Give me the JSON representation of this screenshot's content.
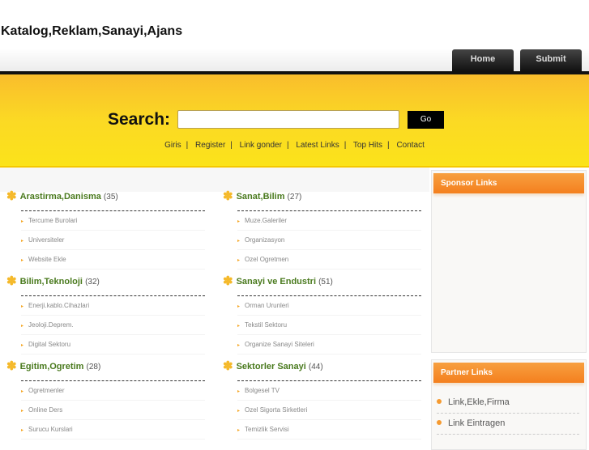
{
  "site_title": "Katalog,Reklam,Sanayi,Ajans",
  "tabs": [
    {
      "label": "Home"
    },
    {
      "label": "Submit"
    }
  ],
  "search": {
    "label": "Search:",
    "value": "",
    "go_label": "Go"
  },
  "links": [
    "Giris",
    "Register",
    "Link gonder",
    "Latest Links",
    "Top Hits",
    "Contact"
  ],
  "link_separator": "|",
  "categories": [
    {
      "title": "Arastirma,Danisma",
      "count": "(35)",
      "items": [
        "Tercume Burolari",
        "Universiteler",
        "Website Ekle"
      ]
    },
    {
      "title": "Sanat,Bilim",
      "count": "(27)",
      "items": [
        "Muze.Galeriler",
        "Organizasyon",
        "Ozel Ogretmen"
      ]
    },
    {
      "title": "Bilim,Teknoloji",
      "count": "(32)",
      "items": [
        "Enerji.kablo.Cihazlari",
        "Jeoloji.Deprem.",
        "Digital Sektoru"
      ]
    },
    {
      "title": "Sanayi ve Endustri",
      "count": "(51)",
      "items": [
        "Orman Urunleri",
        "Tekstil Sektoru",
        "Organize Sanayi Siteleri"
      ]
    },
    {
      "title": "Egitim,Ogretim",
      "count": "(28)",
      "items": [
        "Ogretmenler",
        "Online Ders",
        "Surucu Kurslari"
      ]
    },
    {
      "title": "Sektorler Sanayi",
      "count": "(44)",
      "items": [
        "Bolgesel TV",
        "Ozel Sigorta Sirketleri",
        "Temizlik Servisi"
      ]
    }
  ],
  "sidebar": {
    "sponsor_title": "Sponsor Links",
    "partner_title": "Partner Links",
    "partner_links": [
      "Link,Ekle,Firma",
      "Link Eintragen"
    ]
  },
  "colors": {
    "accent": "#f47f1e",
    "band": "#fbd924",
    "category": "#4a7a1e"
  }
}
